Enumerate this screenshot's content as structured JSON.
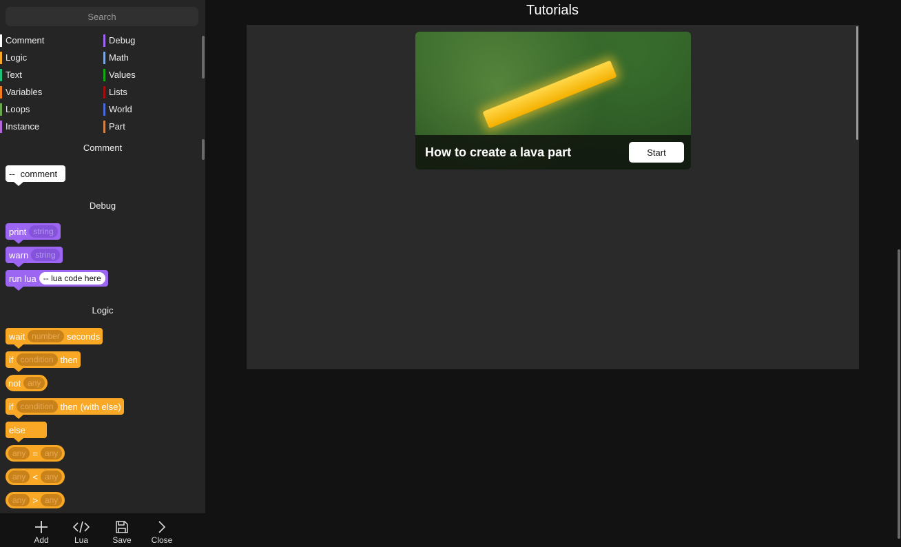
{
  "search": {
    "placeholder": "Search"
  },
  "categories": [
    {
      "label": "Comment",
      "color": "#ffffff"
    },
    {
      "label": "Debug",
      "color": "#9c66f2"
    },
    {
      "label": "Logic",
      "color": "#f9a825"
    },
    {
      "label": "Math",
      "color": "#7fa8e0"
    },
    {
      "label": "Text",
      "color": "#1fbf7a"
    },
    {
      "label": "Values",
      "color": "#14a814"
    },
    {
      "label": "Variables",
      "color": "#f07c1e"
    },
    {
      "label": "Lists",
      "color": "#a01010"
    },
    {
      "label": "Loops",
      "color": "#6aa84f"
    },
    {
      "label": "World",
      "color": "#4a6cd4"
    },
    {
      "label": "Instance",
      "color": "#b26ad8"
    },
    {
      "label": "Part",
      "color": "#d4844a"
    }
  ],
  "sections": {
    "comment": {
      "title": "Comment",
      "block": {
        "prefix": "--",
        "text": "comment"
      }
    },
    "debug": {
      "title": "Debug",
      "print": {
        "label": "print",
        "arg": "string"
      },
      "warn": {
        "label": "warn",
        "arg": "string"
      },
      "run_lua": {
        "label": "run lua",
        "arg": "-- lua code here"
      }
    },
    "logic": {
      "title": "Logic",
      "wait": {
        "label": "wait",
        "arg": "number",
        "suffix": "seconds"
      },
      "if_then": {
        "label": "if",
        "arg": "condition",
        "suffix": "then"
      },
      "not": {
        "label": "not",
        "arg": "any"
      },
      "if_else": {
        "label": "if",
        "arg": "condition",
        "suffix": "then (with else)"
      },
      "else": {
        "label": "else"
      },
      "eq": {
        "left": "any",
        "op": "=",
        "right": "any"
      },
      "lt": {
        "left": "any",
        "op": "<",
        "right": "any"
      },
      "gt": {
        "left": "any",
        "op": ">",
        "right": "any"
      }
    }
  },
  "toolbar": {
    "add": "Add",
    "lua": "Lua",
    "save": "Save",
    "close": "Close"
  },
  "main": {
    "title": "Tutorials",
    "tutorial": {
      "title": "How to create a lava part",
      "start_label": "Start"
    }
  }
}
